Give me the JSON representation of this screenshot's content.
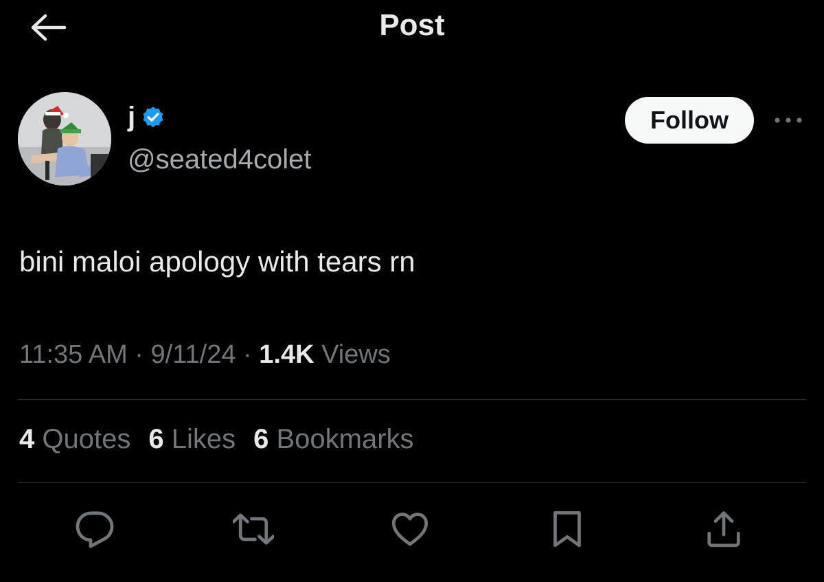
{
  "header": {
    "title": "Post",
    "back_icon": "arrow-left-icon"
  },
  "author": {
    "display_name": "j",
    "handle": "@seated4colet",
    "verified_icon": "verified-badge-icon",
    "verified_color": "#1d9bf0",
    "follow_label": "Follow",
    "more_icon": "more-horizontal-icon"
  },
  "post": {
    "text": "bini maloi apology with tears rn",
    "time": "11:35 AM",
    "date": "9/11/24",
    "views_count": "1.4K",
    "views_label": "Views",
    "separator": "·"
  },
  "stats": {
    "quotes_count": "4",
    "quotes_label": "Quotes",
    "likes_count": "6",
    "likes_label": "Likes",
    "bookmarks_count": "6",
    "bookmarks_label": "Bookmarks"
  },
  "actions": [
    {
      "icon": "reply-icon"
    },
    {
      "icon": "repost-icon"
    },
    {
      "icon": "like-icon"
    },
    {
      "icon": "bookmark-icon"
    },
    {
      "icon": "share-icon"
    }
  ],
  "colors": {
    "background": "#000000",
    "text_primary": "#e7e9ea",
    "text_secondary": "#71767b",
    "divider": "#2f3336",
    "follow_bg": "#f7f9f9"
  }
}
